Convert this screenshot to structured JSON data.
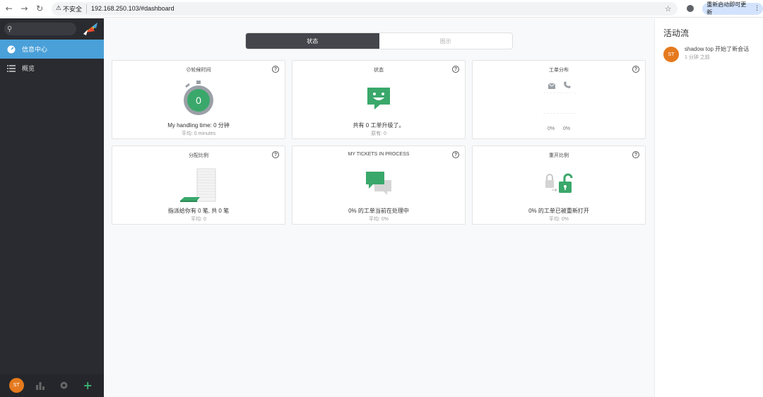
{
  "browser": {
    "security_label": "不安全",
    "url": "192.168.250.103/#dashboard",
    "relaunch_label": "重新启动即可更新"
  },
  "sidebar": {
    "items": [
      {
        "label": "信息中心",
        "icon": "dashboard-icon",
        "active": true
      },
      {
        "label": "概览",
        "icon": "list-icon",
        "active": false
      }
    ],
    "user_initials": "ST"
  },
  "main": {
    "tabs": [
      {
        "label": "状态",
        "active": true
      },
      {
        "label": "图示",
        "active": false
      }
    ],
    "cards": [
      {
        "title": "⊘轮候时间",
        "line1": "My handling time: 0 分钟",
        "line2": "平均: 0 minutes",
        "gauge_value": "0"
      },
      {
        "title": "状态",
        "line1": "共有 0 工单升级了。",
        "line2": "原有: 0"
      },
      {
        "title": "工单分布",
        "pct_email": "0%",
        "pct_phone": "0%"
      },
      {
        "title": "分配比例",
        "line1": "指派给你有 0 笔, 共 0 笔",
        "line2": "平均: 0"
      },
      {
        "title": "MY TICKETS IN PROCESS",
        "line1": "0% 的工单当前在处理中",
        "line2": "平均: 0%"
      },
      {
        "title": "重开比例",
        "line1": "0% 的工单已被重新打开",
        "line2": "平均: 0%"
      }
    ]
  },
  "activity_stream": {
    "title": "活动流",
    "items": [
      {
        "initials": "ST",
        "text": "shadow top 开始了新会话",
        "time": "1 分钟 之前"
      }
    ]
  },
  "colors": {
    "sidebar_bg": "#2a2b30",
    "active_blue": "#4aa0d8",
    "green": "#3aa86b",
    "avatar_orange": "#e57a1e"
  }
}
